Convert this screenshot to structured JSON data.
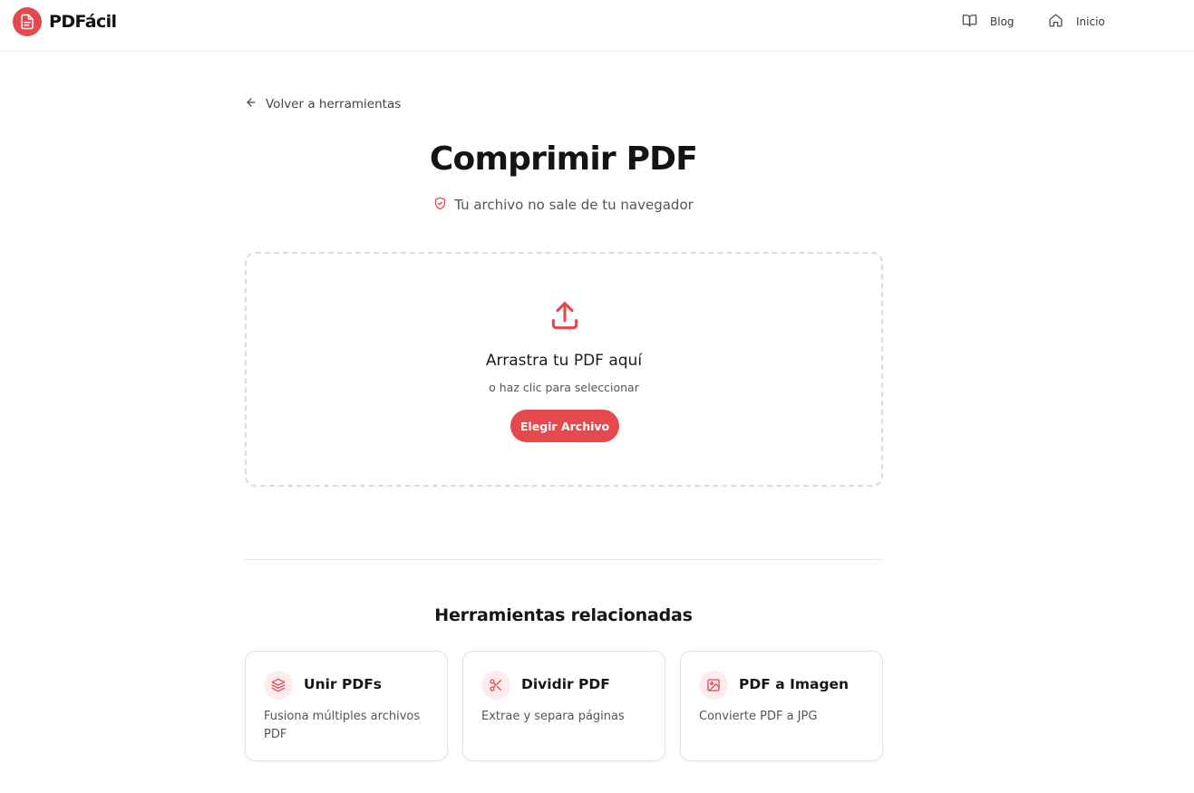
{
  "brand": {
    "name": "PDFácil",
    "accent_color": "#e5484d",
    "icon": "file-text-icon"
  },
  "nav": [
    {
      "label": "Blog",
      "icon": "book-open-icon"
    },
    {
      "label": "Inicio",
      "icon": "home-icon"
    }
  ],
  "back_link": {
    "label": "Volver a herramientas",
    "icon": "arrow-left-icon"
  },
  "page": {
    "title": "Comprimir PDF",
    "privacy_note": "Tu archivo no sale de tu navegador",
    "privacy_icon": "shield-check-icon"
  },
  "dropzone": {
    "icon": "upload-icon",
    "title": "Arrastra tu PDF aquí",
    "subtitle": "o haz clic para seleccionar",
    "button_label": "Elegir Archivo"
  },
  "related": {
    "title": "Herramientas relacionadas",
    "tools": [
      {
        "name": "Unir PDFs",
        "description": "Fusiona múltiples archivos PDF",
        "icon": "layers-icon"
      },
      {
        "name": "Dividir PDF",
        "description": "Extrae y separa páginas",
        "icon": "scissors-icon"
      },
      {
        "name": "PDF a Imagen",
        "description": "Convierte PDF a JPG",
        "icon": "image-icon"
      }
    ]
  }
}
